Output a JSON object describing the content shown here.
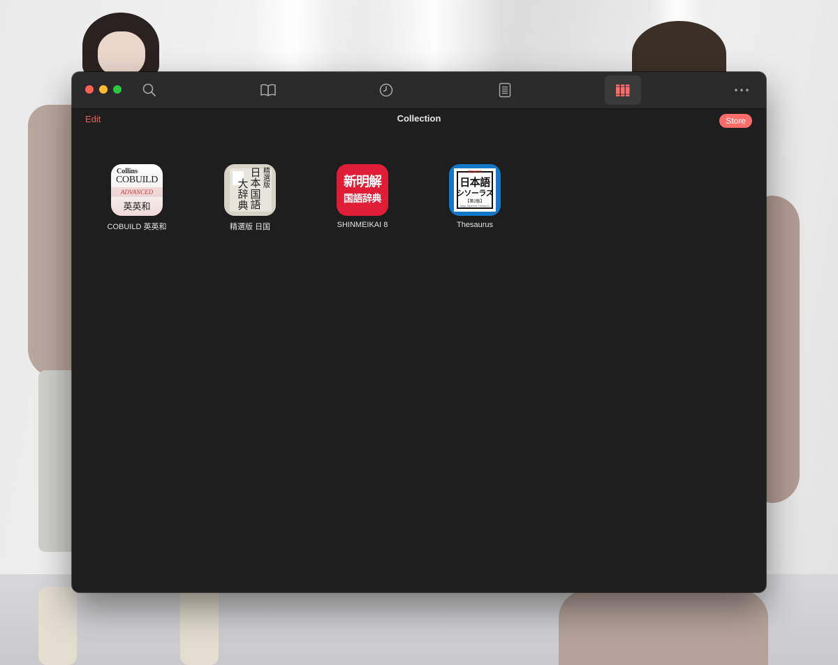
{
  "window": {
    "traffic_lights": [
      "close",
      "minimize",
      "zoom"
    ]
  },
  "toolbar": {
    "icons": [
      "search-icon",
      "book-icon",
      "history-icon",
      "list-icon",
      "collection-icon",
      "more-icon"
    ],
    "selected": "collection",
    "accent_color": "#f0615b"
  },
  "nav": {
    "edit_label": "Edit",
    "title": "Collection",
    "store_label": "Store"
  },
  "collection": {
    "items": [
      {
        "label": "COBUILD 英英和",
        "icon_text": {
          "brand": "Collins",
          "name": "COBUILD",
          "edition": "ADVANCED",
          "subtitle": "英英和"
        }
      },
      {
        "label": "精選版 日国",
        "icon_text": {
          "col1": "精選版",
          "col2": "日本国語",
          "col3": "大辞典"
        }
      },
      {
        "label": "SHINMEIKAI 8",
        "icon_text": {
          "line1": "新明解",
          "line2": "国語辞典"
        }
      },
      {
        "label": "Thesaurus",
        "icon_text": {
          "tiny": "類語新辞典",
          "line1": "日本語",
          "line2": "シソーラス",
          "line3": "【第2版】",
          "line4": "Nago Japanese Thesaurus"
        }
      }
    ]
  }
}
